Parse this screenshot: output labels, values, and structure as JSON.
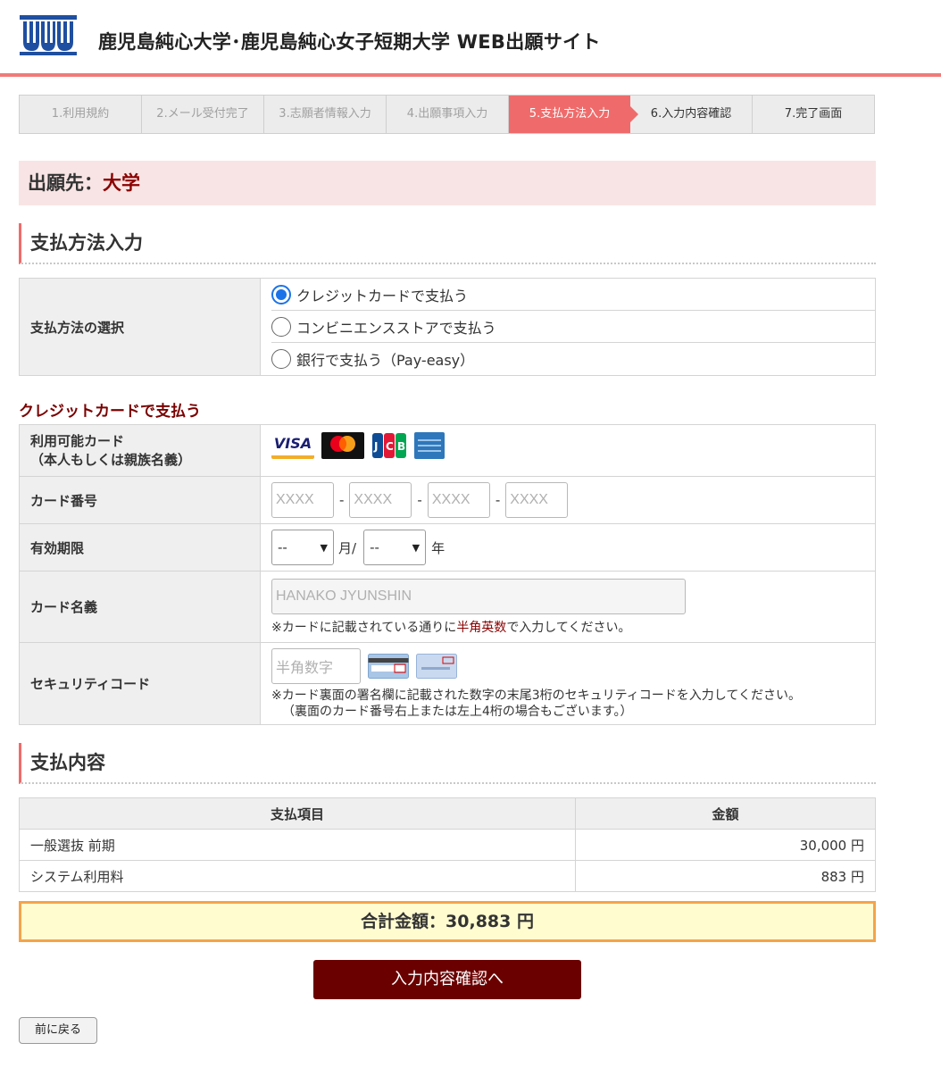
{
  "header": {
    "site_title": "鹿児島純心大学･鹿児島純心女子短期大学 WEB出願サイト"
  },
  "steps": [
    {
      "label": "1.利用規約",
      "state": "done"
    },
    {
      "label": "2.メール受付完了",
      "state": "done"
    },
    {
      "label": "3.志願者情報入力",
      "state": "done"
    },
    {
      "label": "4.出願事項入力",
      "state": "done"
    },
    {
      "label": "5.支払方法入力",
      "state": "active"
    },
    {
      "label": "6.入力内容確認",
      "state": "next"
    },
    {
      "label": "7.完了画面",
      "state": "next"
    }
  ],
  "destination": {
    "label": "出願先：",
    "value": "大学"
  },
  "payment_method": {
    "title": "支払方法入力",
    "row_label": "支払方法の選択",
    "options": [
      {
        "label": "クレジットカードで支払う",
        "selected": true
      },
      {
        "label": "コンビニエンスストアで支払う",
        "selected": false
      },
      {
        "label": "銀行で支払う（Pay-easy）",
        "selected": false
      }
    ]
  },
  "credit": {
    "heading": "クレジットカードで支払う",
    "cards_label_1": "利用可能カード",
    "cards_label_2": "（本人もしくは親族名義）",
    "card_brands": [
      "visa-logo",
      "mastercard-logo",
      "jcb-logo",
      "amex-logo"
    ],
    "card_number_label": "カード番号",
    "card_number_placeholder": "XXXX",
    "card_number_sep": "-",
    "expiry_label": "有効期限",
    "expiry_month_value": "--",
    "expiry_month_unit": "月/",
    "expiry_year_value": "--",
    "expiry_year_unit": "年",
    "name_label": "カード名義",
    "name_placeholder": "HANAKO JYUNSHIN",
    "name_note_pre": "※カードに記載されている通りに",
    "name_note_red": "半角英数",
    "name_note_post": "で入力してください。",
    "cvv_label": "セキュリティコード",
    "cvv_placeholder": "半角数字",
    "cvv_note_1": "※カード裏面の署名欄に記載された数字の末尾3桁のセキュリティコードを入力してください。",
    "cvv_note_2": "（裏面のカード番号右上または左上4桁の場合もございます。）"
  },
  "payment_details": {
    "title": "支払内容",
    "col_item": "支払項目",
    "col_amount": "金額",
    "rows": [
      {
        "item": "一般選抜 前期",
        "amount": "30,000 円"
      },
      {
        "item": "システム利用料",
        "amount": "883 円"
      }
    ],
    "total": "合計金額：30,883 円"
  },
  "buttons": {
    "confirm": "入力内容確認へ",
    "back": "前に戻る"
  },
  "colors": {
    "accent": "#ef6b6b",
    "primary": "#6a0000",
    "dest_bg": "#f8e4e4",
    "total_bg": "#fffcd0",
    "total_border": "#f4a44a"
  }
}
